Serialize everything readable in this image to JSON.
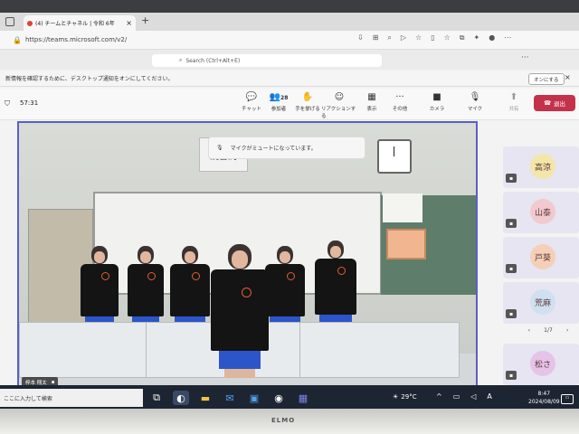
{
  "browser": {
    "tab_title": "(4) チームとチャネル | 令和 6年",
    "new_tab": "+",
    "url": "https://teams.microsoft.com/v2/"
  },
  "teams": {
    "search_placeholder": "Search (Ctrl+Alt+E)",
    "banner_text": "新情報を確認するために、デスクトップ通知をオンにしてください。",
    "banner_button": "オンにする",
    "timer": "57:31",
    "toolbar": [
      {
        "icon": "chat-icon",
        "glyph": "💬",
        "label": "チャット",
        "count": ""
      },
      {
        "icon": "people-icon",
        "glyph": "👥",
        "label": "参加者",
        "count": "28"
      },
      {
        "icon": "hand-icon",
        "glyph": "✋",
        "label": "手を挙げる",
        "count": ""
      },
      {
        "icon": "reaction-icon",
        "glyph": "☺",
        "label": "リアクションする",
        "count": ""
      },
      {
        "icon": "view-icon",
        "glyph": "▦",
        "label": "表示",
        "count": ""
      },
      {
        "icon": "more-icon",
        "glyph": "···",
        "label": "その他",
        "count": ""
      },
      {
        "icon": "camera-icon",
        "glyph": "■",
        "label": "カメラ",
        "count": ""
      },
      {
        "icon": "mic-off-icon",
        "glyph": "🎙",
        "label": "マイク",
        "count": ""
      },
      {
        "icon": "share-icon",
        "glyph": "⬆",
        "label": "共有",
        "count": ""
      }
    ],
    "leave_label": "退出",
    "mute_toast": "マイクがミュートになっています。",
    "video_sign": "読書間",
    "speaker_name": "梓本 翔太",
    "participants": [
      {
        "name": "高涼",
        "color": "#f3e6a8"
      },
      {
        "name": "山泰",
        "color": "#f2c9cf"
      },
      {
        "name": "戸葵",
        "color": "#f6cfb8"
      },
      {
        "name": "荒麻",
        "color": "#cfe0f0"
      },
      {
        "name": "松さ",
        "color": "#e6c3e8"
      }
    ],
    "page_indicator": "1/7"
  },
  "taskbar": {
    "search_placeholder": "ここに入力して検索",
    "temperature": "29°C",
    "time": "8:47",
    "date": "2024/08/09",
    "ime": "A",
    "tray_up": "^"
  },
  "monitor_brand": "ELMO"
}
